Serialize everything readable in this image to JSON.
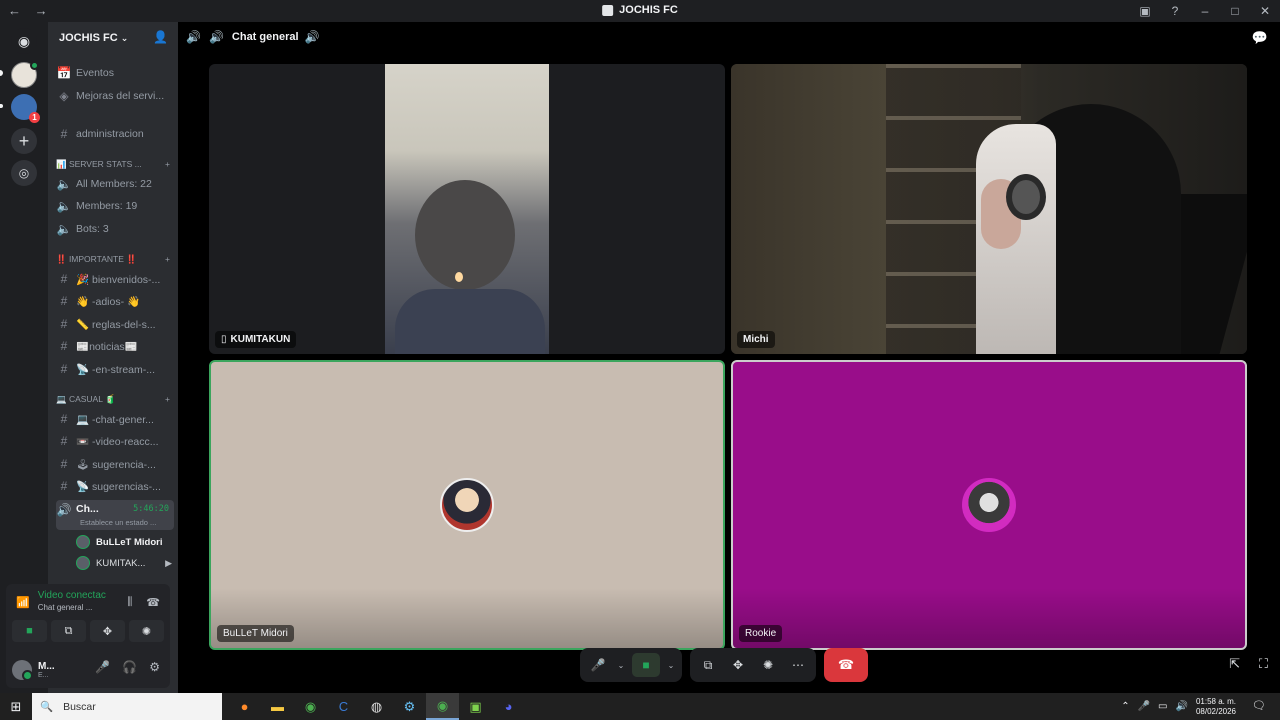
{
  "window": {
    "title": "JOCHIS FC",
    "back": "←",
    "forward": "→",
    "inbox_icon": "inbox-icon",
    "help_icon": "help-icon",
    "minimize": "–",
    "maximize": "□",
    "close": "✕"
  },
  "servers": {
    "discord_icon": "discord-icon",
    "badge_count": "1",
    "add": "+",
    "explore": "⌖"
  },
  "guild": {
    "name": "JOCHIS FC",
    "caret": "⌄",
    "invite_icon": "add-person-icon"
  },
  "channels": {
    "eventos": "Eventos",
    "mejoras": "Mejoras del servi...",
    "administracion": "administracion",
    "cat_server_stats": "📊 SERVER STATS ...",
    "all_members": "All Members: 22",
    "members": "Members: 19",
    "bots": "Bots: 3",
    "cat_importante": "‼️ IMPORTANTE ‼️",
    "bienvenidos": "🎉 bienvenidos-...",
    "adios": "👋 -adios- 👋",
    "reglas": "📏 reglas-del-s...",
    "noticias": "📰noticias📰",
    "en_stream": "📡 -en-stream-...",
    "cat_casual": "💻 CASUAL 🧃",
    "chat_general": "💻 -chat-gener...",
    "video_reacc": "📼 -video-reacc...",
    "sugerencia": "🕹 sugerencia-...",
    "sugerencias": "📡 sugerencias-...",
    "voice_active": "Ch...",
    "voice_timer": "5:46:20",
    "voice_status": "Establece un estado ...",
    "voice_users": [
      "BuLLeT Midori",
      "KUMITAK..."
    ],
    "hash": "#",
    "plus": "+"
  },
  "voice_panel": {
    "title": "Video conectac",
    "subtitle": "Chat general ...",
    "user_initial": "M...",
    "user_sub": "E..."
  },
  "header": {
    "channel": "Chat general"
  },
  "tiles": [
    {
      "name": "KUMITAKUN"
    },
    {
      "name": "Michi"
    },
    {
      "name": "BuLLeT Midori"
    },
    {
      "name": "Rookie"
    }
  ],
  "taskbar": {
    "search_placeholder": "Buscar",
    "time": "01:58 a. m.",
    "date": "08/02/2026"
  },
  "colors": {
    "accent_green": "#23a55a",
    "end_call": "#da373c",
    "rookie_bg": "#990d8a",
    "bullet_bg": "#c8bcb1"
  }
}
